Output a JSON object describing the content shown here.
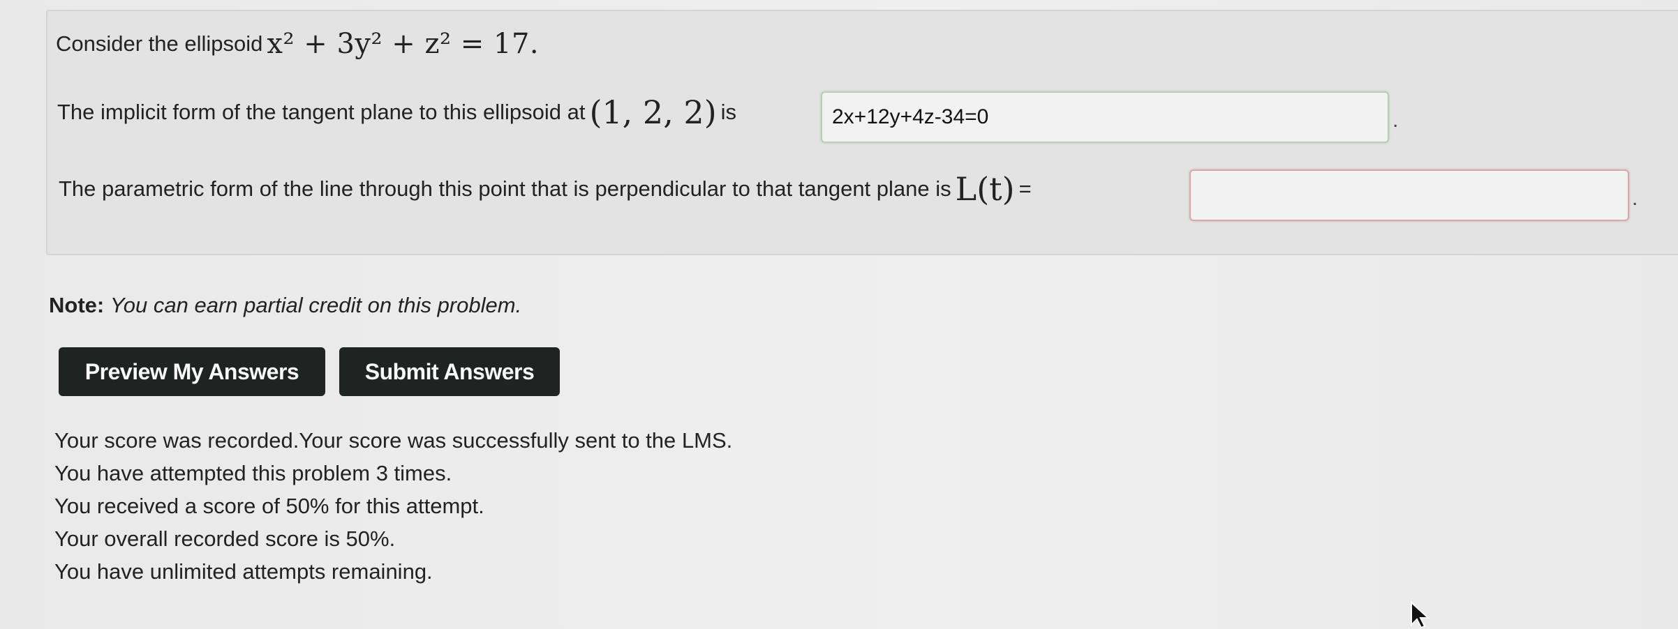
{
  "problem": {
    "intro_text": "Consider the ellipsoid",
    "equation": "x² + 3y² + z² = 17.",
    "tangent_prefix": "The implicit form of the tangent plane to this ellipsoid at",
    "point": "(1, 2, 2)",
    "tangent_is": "is",
    "tangent_answer": "2x+12y+4z-34=0",
    "line_prefix": "The parametric form of the line through this point that is perpendicular to that tangent plane is",
    "line_symbol": "L(t)",
    "line_equals": "=",
    "line_answer": "",
    "period": "."
  },
  "note": {
    "label": "Note:",
    "text": "You can earn partial credit on this problem."
  },
  "buttons": {
    "preview": "Preview My Answers",
    "submit": "Submit Answers"
  },
  "status": [
    "Your score was recorded.Your score was successfully sent to the LMS.",
    "You have attempted this problem 3 times.",
    "You received a score of 50% for this attempt.",
    "Your overall recorded score is 50%.",
    "You have unlimited attempts remaining."
  ],
  "colors": {
    "button_bg": "#1d2422",
    "correct_border": "#b9cfb0",
    "incorrect_border": "#d8a8ad"
  },
  "icons": {
    "cursor": "mouse-pointer-icon"
  }
}
